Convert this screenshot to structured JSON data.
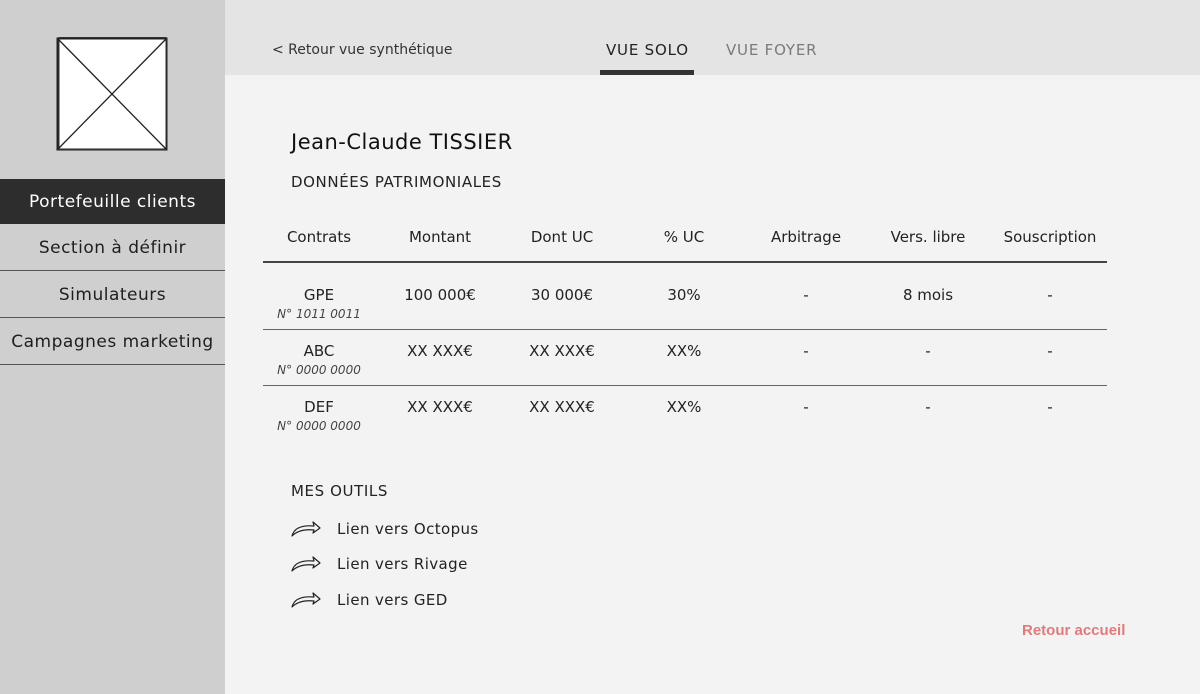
{
  "sidebar": {
    "logo_icon": "image-placeholder-icon",
    "items": [
      {
        "label": "Portefeuille clients",
        "active": true
      },
      {
        "label": "Section à définir",
        "active": false
      },
      {
        "label": "Simulateurs",
        "active": false
      },
      {
        "label": "Campagnes marketing",
        "active": false
      }
    ]
  },
  "topbar": {
    "back_label": "< Retour vue synthétique",
    "tabs": [
      {
        "label": "VUE SOLO",
        "active": true
      },
      {
        "label": "VUE FOYER",
        "active": false
      }
    ]
  },
  "client": {
    "name": "Jean-Claude TISSIER",
    "section_title": "DONNÉES PATRIMONIALES"
  },
  "table": {
    "headers": [
      "Contrats",
      "Montant",
      "Dont UC",
      "% UC",
      "Arbitrage",
      "Vers. libre",
      "Souscription"
    ],
    "rows": [
      {
        "contract": "GPE",
        "number": "N° 1011 0011",
        "montant": "100 000€",
        "dont_uc": "30 000€",
        "pct_uc": "30%",
        "arbitrage": "-",
        "vers_libre": "8 mois",
        "souscription": "-"
      },
      {
        "contract": "ABC",
        "number": "N° 0000 0000",
        "montant": "XX XXX€",
        "dont_uc": "XX XXX€",
        "pct_uc": "XX%",
        "arbitrage": "-",
        "vers_libre": "-",
        "souscription": "-"
      },
      {
        "contract": "DEF",
        "number": "N° 0000 0000",
        "montant": "XX XXX€",
        "dont_uc": "XX XXX€",
        "pct_uc": "XX%",
        "arbitrage": "-",
        "vers_libre": "-",
        "souscription": "-"
      }
    ]
  },
  "tools": {
    "title": "MES OUTILS",
    "icon": "curved-arrow-icon",
    "items": [
      {
        "label": "Lien vers Octopus"
      },
      {
        "label": "Lien vers Rivage"
      },
      {
        "label": "Lien vers GED"
      }
    ]
  },
  "footer": {
    "home_label": "Retour accueil",
    "home_color": "#e07b7b"
  },
  "colors": {
    "sidebar_bg": "#cfcfcf",
    "active_nav_bg": "#2d2d2d",
    "topbar_bg": "#e4e4e4"
  }
}
